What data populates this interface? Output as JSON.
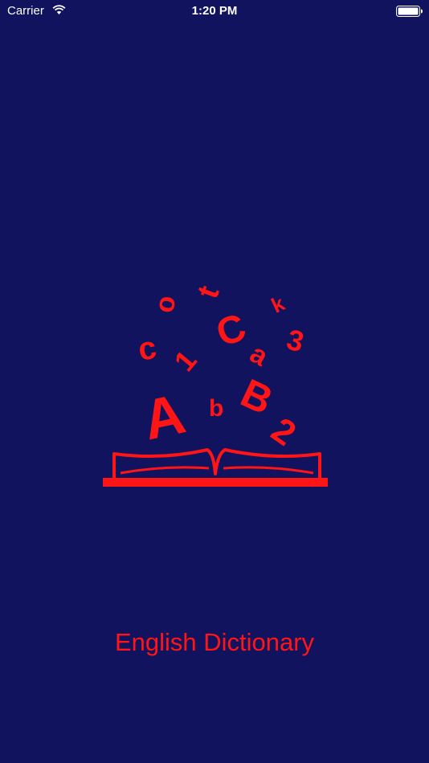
{
  "status_bar": {
    "carrier": "Carrier",
    "time": "1:20 PM",
    "wifi_icon": "wifi-icon",
    "battery_icon": "battery-full-icon"
  },
  "splash": {
    "title": "English Dictionary",
    "logo_icon": "book-with-flying-letters-icon",
    "logo_glyphs": [
      "o",
      "t",
      "k",
      "c",
      "1",
      "C",
      "a",
      "3",
      "A",
      "b",
      "B",
      "2"
    ],
    "accent_color": "#ff1515",
    "background_color": "#12135e"
  }
}
